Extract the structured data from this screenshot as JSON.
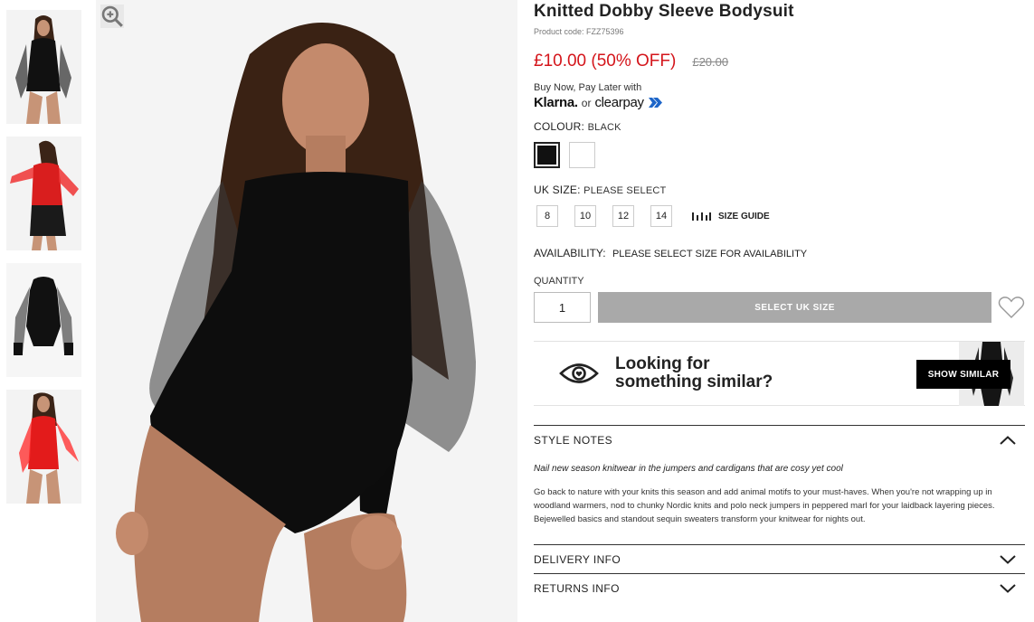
{
  "product": {
    "title": "Knitted Dobby Sleeve Bodysuit",
    "code": "Product code: FZZ75396",
    "price": "£10.00 (50% OFF)",
    "old_price": "£20.00"
  },
  "payment": {
    "bnpl_text": "Buy Now, Pay Later with",
    "klarna": "Klarna.",
    "or": "or",
    "clearpay": "clearpay"
  },
  "colour": {
    "label": "COLOUR:",
    "value": "BLACK",
    "swatches": [
      {
        "name": "black",
        "color": "#111111",
        "selected": true
      },
      {
        "name": "white",
        "color": "#ffffff",
        "selected": false
      }
    ]
  },
  "size": {
    "label": "UK SIZE:",
    "value": "PLEASE SELECT",
    "options": [
      "8",
      "10",
      "12",
      "14"
    ],
    "guide": "SIZE GUIDE"
  },
  "availability": {
    "label": "AVAILABILITY:",
    "value": "PLEASE SELECT SIZE FOR AVAILABILITY"
  },
  "quantity": {
    "label": "QUANTITY",
    "value": "1"
  },
  "actions": {
    "add_button": "SELECT UK SIZE",
    "show_similar": "SHOW SIMILAR"
  },
  "similar": {
    "line1": "Looking for",
    "line2": "something similar?"
  },
  "sections": {
    "style_notes": "STYLE NOTES",
    "notes_title": "Nail new season knitwear in the jumpers and cardigans that are cosy yet cool",
    "notes_body": "Go back to nature with your knits this season and add animal motifs to your must-haves. When you're not wrapping up in woodland warmers, nod to chunky Nordic knits and polo neck jumpers in peppered marl for your laidback layering pieces. Bejewelled basics and standout sequin sweaters transform your knitwear for nights out.",
    "delivery": "DELIVERY INFO",
    "returns": "RETURNS INFO"
  },
  "icons": {
    "zoom": "zoom-icon",
    "heart": "heart-icon",
    "eye": "eye-icon",
    "ruler": "ruler-icon",
    "chevron_up": "chevron-up-icon",
    "chevron_down": "chevron-down-icon"
  },
  "colors": {
    "sale_red": "#d4151b",
    "disabled_button": "#a9a9a9",
    "clearpay_blue": "#1e66c9"
  }
}
